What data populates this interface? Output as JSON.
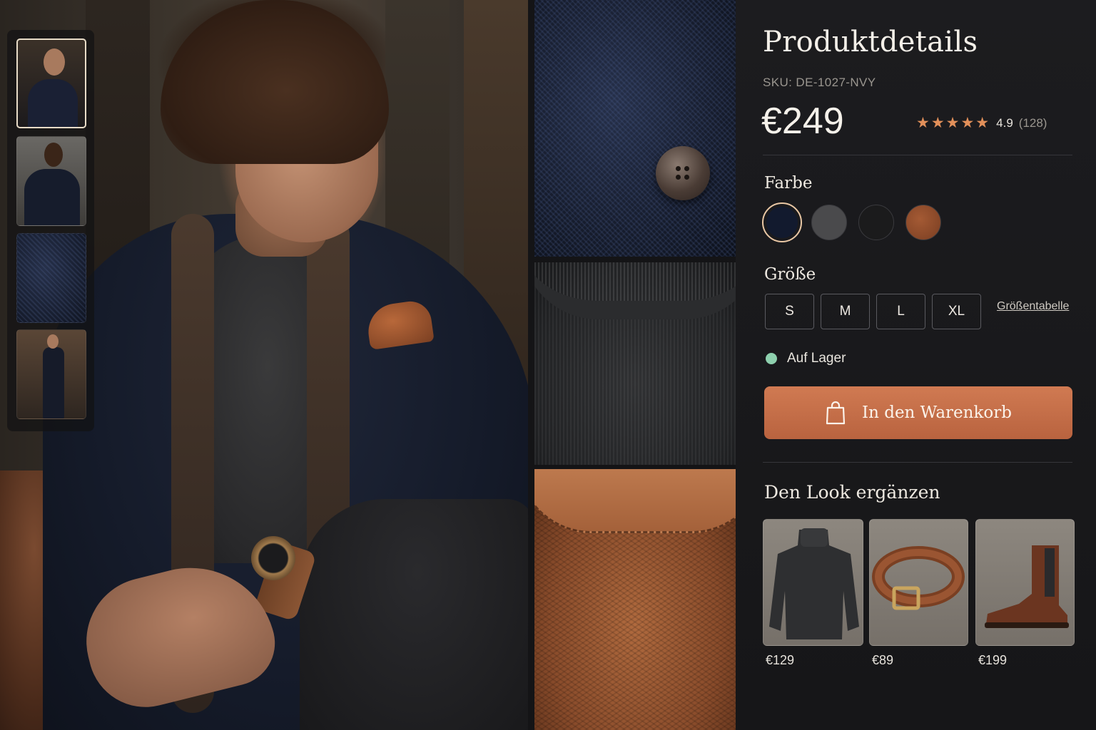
{
  "gallery": {
    "thumbnails": [
      "thumb-portrait",
      "thumb-back-view",
      "thumb-fabric-closeup",
      "thumb-full-length"
    ],
    "active_thumbnail": 0
  },
  "product": {
    "title": "Produktdetails",
    "sku": "SKU: DE-1027-NVY",
    "price": "€249",
    "stars": "★★★★★",
    "rating": "4.9",
    "review_count": "(128)"
  },
  "color": {
    "label": "Farbe",
    "options": [
      "#121a2e",
      "#4a4a4c",
      "#1b1b1c",
      "#8a4a2c"
    ],
    "selected": 0
  },
  "size": {
    "label": "Größe",
    "options": [
      "S",
      "M",
      "L",
      "XL"
    ],
    "chart_link": "Größentabelle"
  },
  "stock": {
    "text": "Auf Lager",
    "color": "#8ed0ae"
  },
  "cart": {
    "label": "In den Warenkorb",
    "icon": "shopping-bag-icon",
    "color": "#c96f48"
  },
  "complete_look": {
    "title": "Den Look ergänzen",
    "items": [
      {
        "product": "turtleneck-sweater",
        "price": "€129"
      },
      {
        "product": "leather-belt",
        "price": "€89"
      },
      {
        "product": "chelsea-boot",
        "price": "€199"
      }
    ]
  }
}
